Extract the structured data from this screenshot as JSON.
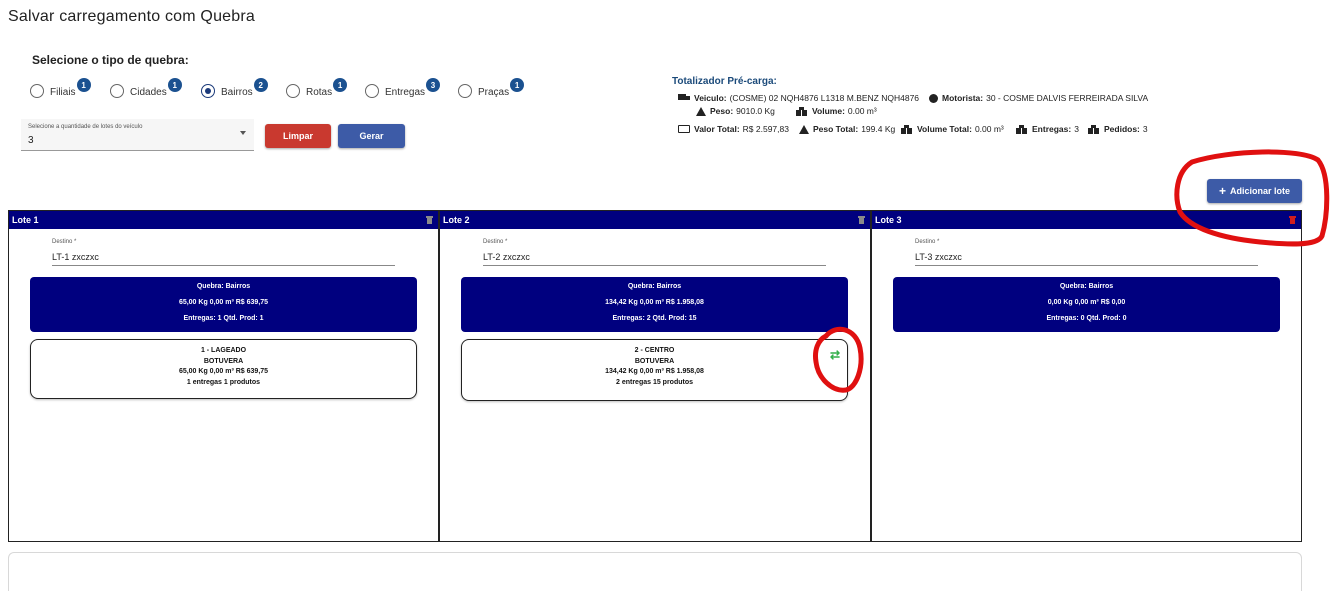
{
  "title": "Salvar carregamento com Quebra",
  "quebra_section": {
    "label": "Selecione o tipo de quebra:",
    "options": [
      {
        "label": "Filiais",
        "badge": "1",
        "checked": false
      },
      {
        "label": "Cidades",
        "badge": "1",
        "checked": false
      },
      {
        "label": "Bairros",
        "badge": "2",
        "checked": true
      },
      {
        "label": "Rotas",
        "badge": "1",
        "checked": false
      },
      {
        "label": "Entregas",
        "badge": "3",
        "checked": false
      },
      {
        "label": "Praças",
        "badge": "1",
        "checked": false
      }
    ]
  },
  "lotes_select": {
    "label": "Selecione a quantidade de lotes do veículo",
    "value": "3"
  },
  "buttons": {
    "limpar": "Limpar",
    "gerar": "Gerar",
    "adicionar": "Adicionar lote"
  },
  "totalizador": {
    "title": "Totalizador Pré-carga:",
    "veiculo_label": "Veiculo:",
    "veiculo_value": "(COSME) 02 NQH4876 L1318 M.BENZ NQH4876",
    "motorista_label": "Motorista:",
    "motorista_value": "30 - COSME DALVIS FERREIRADA SILVA",
    "peso_label": "Peso:",
    "peso_value": "9010.0 Kg",
    "volume_label": "Volume:",
    "volume_value": "0.00 m³",
    "valor_total_label": "Valor Total:",
    "valor_total_value": "R$ 2.597,83",
    "peso_total_label": "Peso Total:",
    "peso_total_value": "199.4 Kg",
    "volume_total_label": "Volume Total:",
    "volume_total_value": "0.00 m³",
    "entregas_label": "Entregas:",
    "entregas_value": "3",
    "pedidos_label": "Pedidos:",
    "pedidos_value": "3"
  },
  "lotes": [
    {
      "title": "Lote 1",
      "destino_label": "Destino *",
      "destino_value": "LT-1 zxczxc",
      "summary": {
        "quebra": "Quebra: Bairros",
        "totals": "65,00 Kg  0,00 m³  R$ 639,75",
        "counts": "Entregas: 1  Qtd. Prod: 1"
      },
      "card": {
        "line1": "1 - LAGEADO",
        "line2": "BOTUVERA",
        "line3": "65,00 Kg  0,00 m³  R$ 639,75",
        "line4": "1 entregas  1 produtos"
      }
    },
    {
      "title": "Lote 2",
      "destino_label": "Destino *",
      "destino_value": "LT-2 zxczxc",
      "summary": {
        "quebra": "Quebra: Bairros",
        "totals": "134,42 Kg  0,00 m³  R$ 1.958,08",
        "counts": "Entregas: 2  Qtd. Prod: 15"
      },
      "card": {
        "line1": "2 - CENTRO",
        "line2": "BOTUVERA",
        "line3": "134,42 Kg  0,00 m³  R$ 1.958,08",
        "line4": "2 entregas  15 produtos"
      }
    },
    {
      "title": "Lote 3",
      "destino_label": "Destino *",
      "destino_value": "LT-3 zxczxc",
      "summary": {
        "quebra": "Quebra: Bairros",
        "totals": "0,00 Kg  0,00 m³  R$ 0,00",
        "counts": "Entregas: 0  Qtd. Prod: 0"
      }
    }
  ],
  "colors": {
    "lote_header": "#00007f",
    "primary_button": "#3d5ba7",
    "danger_button": "#c9392f",
    "badge": "#1b5190",
    "swap_icon": "#33b04a",
    "annotation": "#e01010"
  }
}
